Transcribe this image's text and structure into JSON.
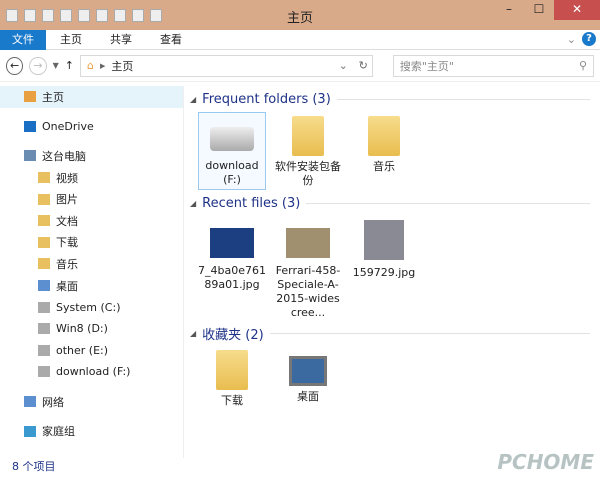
{
  "window": {
    "title": "主页"
  },
  "ribbon": {
    "tabs": [
      "文件",
      "主页",
      "共享",
      "查看"
    ]
  },
  "nav": {
    "address": "主页",
    "search_placeholder": "搜索\"主页\""
  },
  "sidebar": {
    "items": [
      {
        "label": "主页",
        "icon": "home-icon",
        "indent": 0,
        "color": "#e8a040"
      },
      {
        "label": "OneDrive",
        "icon": "cloud-icon",
        "indent": 0,
        "color": "#1a6fc4"
      },
      {
        "label": "这台电脑",
        "icon": "computer-icon",
        "indent": 0,
        "color": "#6a8cb0"
      },
      {
        "label": "视频",
        "icon": "folder-icon",
        "indent": 1,
        "color": "#e8c060"
      },
      {
        "label": "图片",
        "icon": "folder-icon",
        "indent": 1,
        "color": "#e8c060"
      },
      {
        "label": "文档",
        "icon": "folder-icon",
        "indent": 1,
        "color": "#e8c060"
      },
      {
        "label": "下载",
        "icon": "folder-icon",
        "indent": 1,
        "color": "#e8c060"
      },
      {
        "label": "音乐",
        "icon": "folder-icon",
        "indent": 1,
        "color": "#e8c060"
      },
      {
        "label": "桌面",
        "icon": "folder-icon",
        "indent": 1,
        "color": "#5b8fd0"
      },
      {
        "label": "System (C:)",
        "icon": "drive-icon",
        "indent": 1,
        "color": "#aaaaaa"
      },
      {
        "label": "Win8 (D:)",
        "icon": "drive-icon",
        "indent": 1,
        "color": "#aaaaaa"
      },
      {
        "label": "other (E:)",
        "icon": "drive-icon",
        "indent": 1,
        "color": "#aaaaaa"
      },
      {
        "label": "download (F:)",
        "icon": "drive-icon",
        "indent": 1,
        "color": "#aaaaaa"
      },
      {
        "label": "网络",
        "icon": "network-icon",
        "indent": 0,
        "color": "#5b8fd0"
      },
      {
        "label": "家庭组",
        "icon": "homegroup-icon",
        "indent": 0,
        "color": "#3a9ad0"
      }
    ]
  },
  "groups": [
    {
      "title": "Frequent folders (3)",
      "items": [
        {
          "label": "download (F:)",
          "type": "drive"
        },
        {
          "label": "软件安装包备份",
          "type": "folder"
        },
        {
          "label": "音乐",
          "type": "folder"
        }
      ]
    },
    {
      "title": "Recent files (3)",
      "items": [
        {
          "label": "7_4ba0e76189a01.jpg",
          "type": "image",
          "color": "#1b3f80"
        },
        {
          "label": "Ferrari-458-Speciale-A-2015-widescree...",
          "type": "image",
          "color": "#a09070"
        },
        {
          "label": "159729.jpg",
          "type": "image",
          "color": "#8a8a95"
        }
      ]
    },
    {
      "title": "收藏夹 (2)",
      "items": [
        {
          "label": "下载",
          "type": "folder"
        },
        {
          "label": "桌面",
          "type": "desktop"
        }
      ]
    }
  ],
  "status": {
    "count": "8 个项目"
  },
  "watermark": "PCHOME"
}
